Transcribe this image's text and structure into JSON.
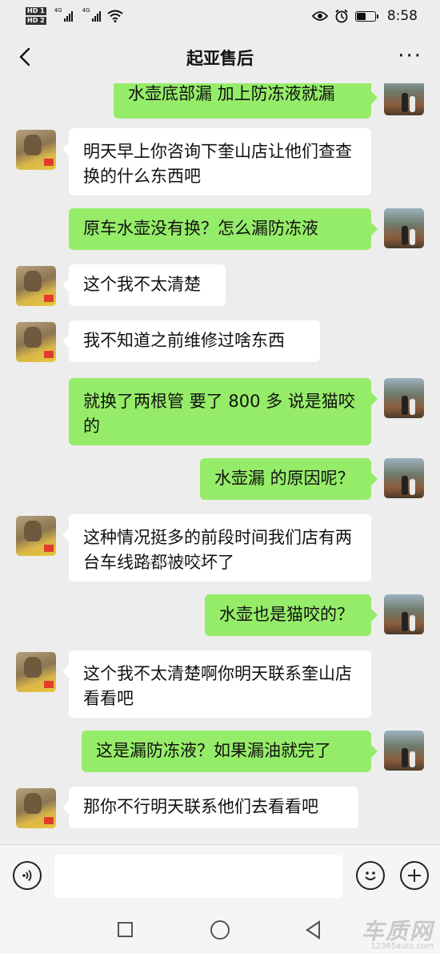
{
  "status_bar": {
    "hd1": "HD 1",
    "hd2": "HD 2",
    "net1": "4G",
    "net2": "4G",
    "time": "8:58"
  },
  "nav": {
    "title": "起亚售后",
    "more": "···"
  },
  "messages": [
    {
      "side": "out",
      "text": "水壶底部漏 加上防冻液就漏"
    },
    {
      "side": "in",
      "text": "明天早上你咨询下奎山店让他们查查换的什么东西吧"
    },
    {
      "side": "out",
      "text": "原车水壶没有换？怎么漏防冻液"
    },
    {
      "side": "in",
      "text": "这个我不太清楚"
    },
    {
      "side": "in",
      "text": "我不知道之前维修过啥东西"
    },
    {
      "side": "out",
      "text": "就换了两根管 要了 800 多 说是猫咬的"
    },
    {
      "side": "out",
      "text": "水壶漏 的原因呢？"
    },
    {
      "side": "in",
      "text": "这种情况挺多的前段时间我们店有两台车线路都被咬坏了"
    },
    {
      "side": "out",
      "text": "水壶也是猫咬的？"
    },
    {
      "side": "in",
      "text": "这个我不太清楚啊你明天联系奎山店看看吧"
    },
    {
      "side": "out",
      "text": "这是漏防冻液？如果漏油就完了"
    },
    {
      "side": "in",
      "text": "那你不行明天联系他们去看看吧"
    }
  ],
  "watermark": "www.123",
  "input": {
    "placeholder": ""
  },
  "logo": {
    "cn": "车质网",
    "en": "12365auto.com"
  },
  "icons": [
    "back-arrow-icon",
    "more-icon",
    "voice-icon",
    "emoji-icon",
    "plus-icon",
    "square-icon",
    "home-circle-icon",
    "back-triangle-icon",
    "eye-icon",
    "alarm-icon",
    "battery-icon",
    "wifi-icon",
    "signal-icon"
  ]
}
